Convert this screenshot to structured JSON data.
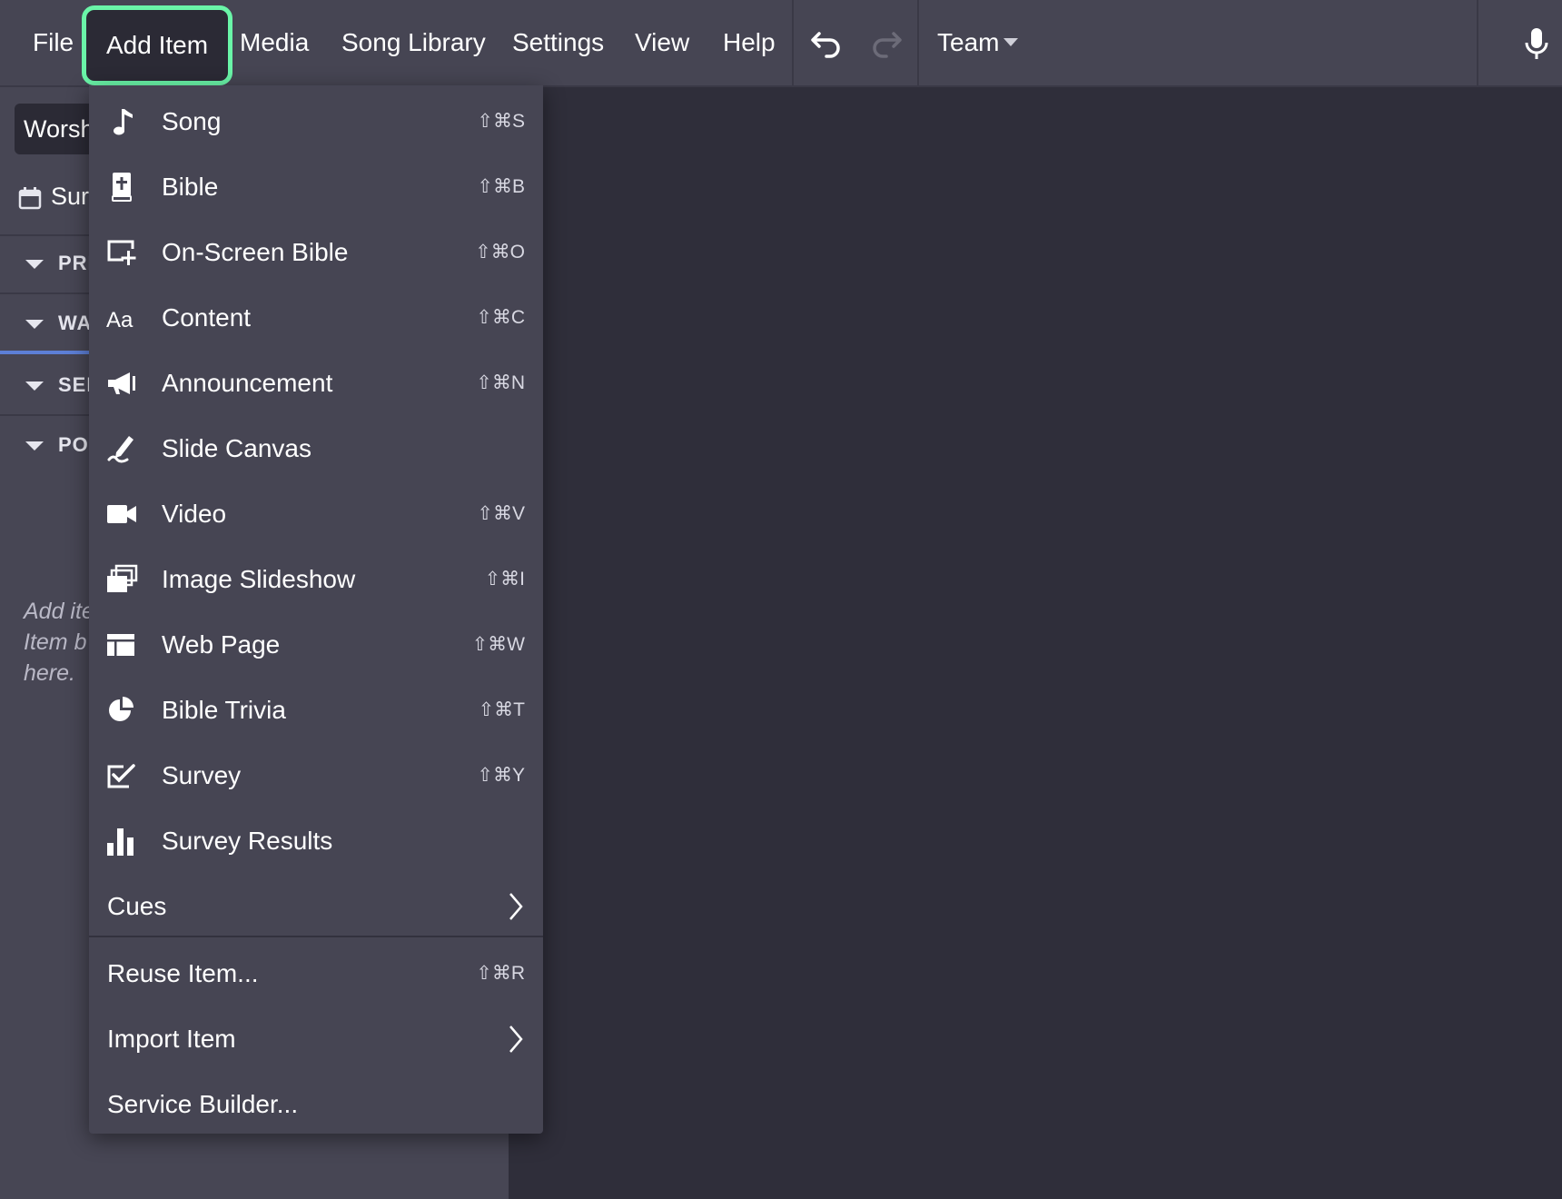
{
  "menubar": {
    "items": [
      "File",
      "Add Item",
      "Media",
      "Song Library",
      "Settings",
      "View",
      "Help"
    ],
    "active": "Add Item",
    "team_label": "Team",
    "accent_color": "#6af5a8"
  },
  "sidebar": {
    "tab_label": "Worsh",
    "date_label": "Sur",
    "sections": [
      "PRI",
      "WA",
      "SEF",
      "POS"
    ],
    "hint_lines": [
      "Add ite",
      "Item b",
      "here."
    ]
  },
  "add_item_menu": {
    "items": [
      {
        "label": "Song",
        "shortcut": "⇧⌘S",
        "icon": "music-note-icon"
      },
      {
        "label": "Bible",
        "shortcut": "⇧⌘B",
        "icon": "bible-icon"
      },
      {
        "label": "On-Screen Bible",
        "shortcut": "⇧⌘O",
        "icon": "screen-add-icon"
      },
      {
        "label": "Content",
        "shortcut": "⇧⌘C",
        "icon": "text-aa-icon"
      },
      {
        "label": "Announcement",
        "shortcut": "⇧⌘N",
        "icon": "megaphone-icon"
      },
      {
        "label": "Slide Canvas",
        "shortcut": "",
        "icon": "pen-icon"
      },
      {
        "label": "Video",
        "shortcut": "⇧⌘V",
        "icon": "video-camera-icon"
      },
      {
        "label": "Image Slideshow",
        "shortcut": "⇧⌘I",
        "icon": "image-stack-icon"
      },
      {
        "label": "Web Page",
        "shortcut": "⇧⌘W",
        "icon": "web-page-icon"
      },
      {
        "label": "Bible Trivia",
        "shortcut": "⇧⌘T",
        "icon": "pie-chart-icon"
      },
      {
        "label": "Survey",
        "shortcut": "⇧⌘Y",
        "icon": "survey-check-icon"
      },
      {
        "label": "Survey Results",
        "shortcut": "",
        "icon": "bar-chart-icon"
      }
    ],
    "cues_label": "Cues",
    "reuse": {
      "label": "Reuse Item...",
      "shortcut": "⇧⌘R"
    },
    "import_label": "Import Item",
    "service_builder_label": "Service Builder..."
  }
}
